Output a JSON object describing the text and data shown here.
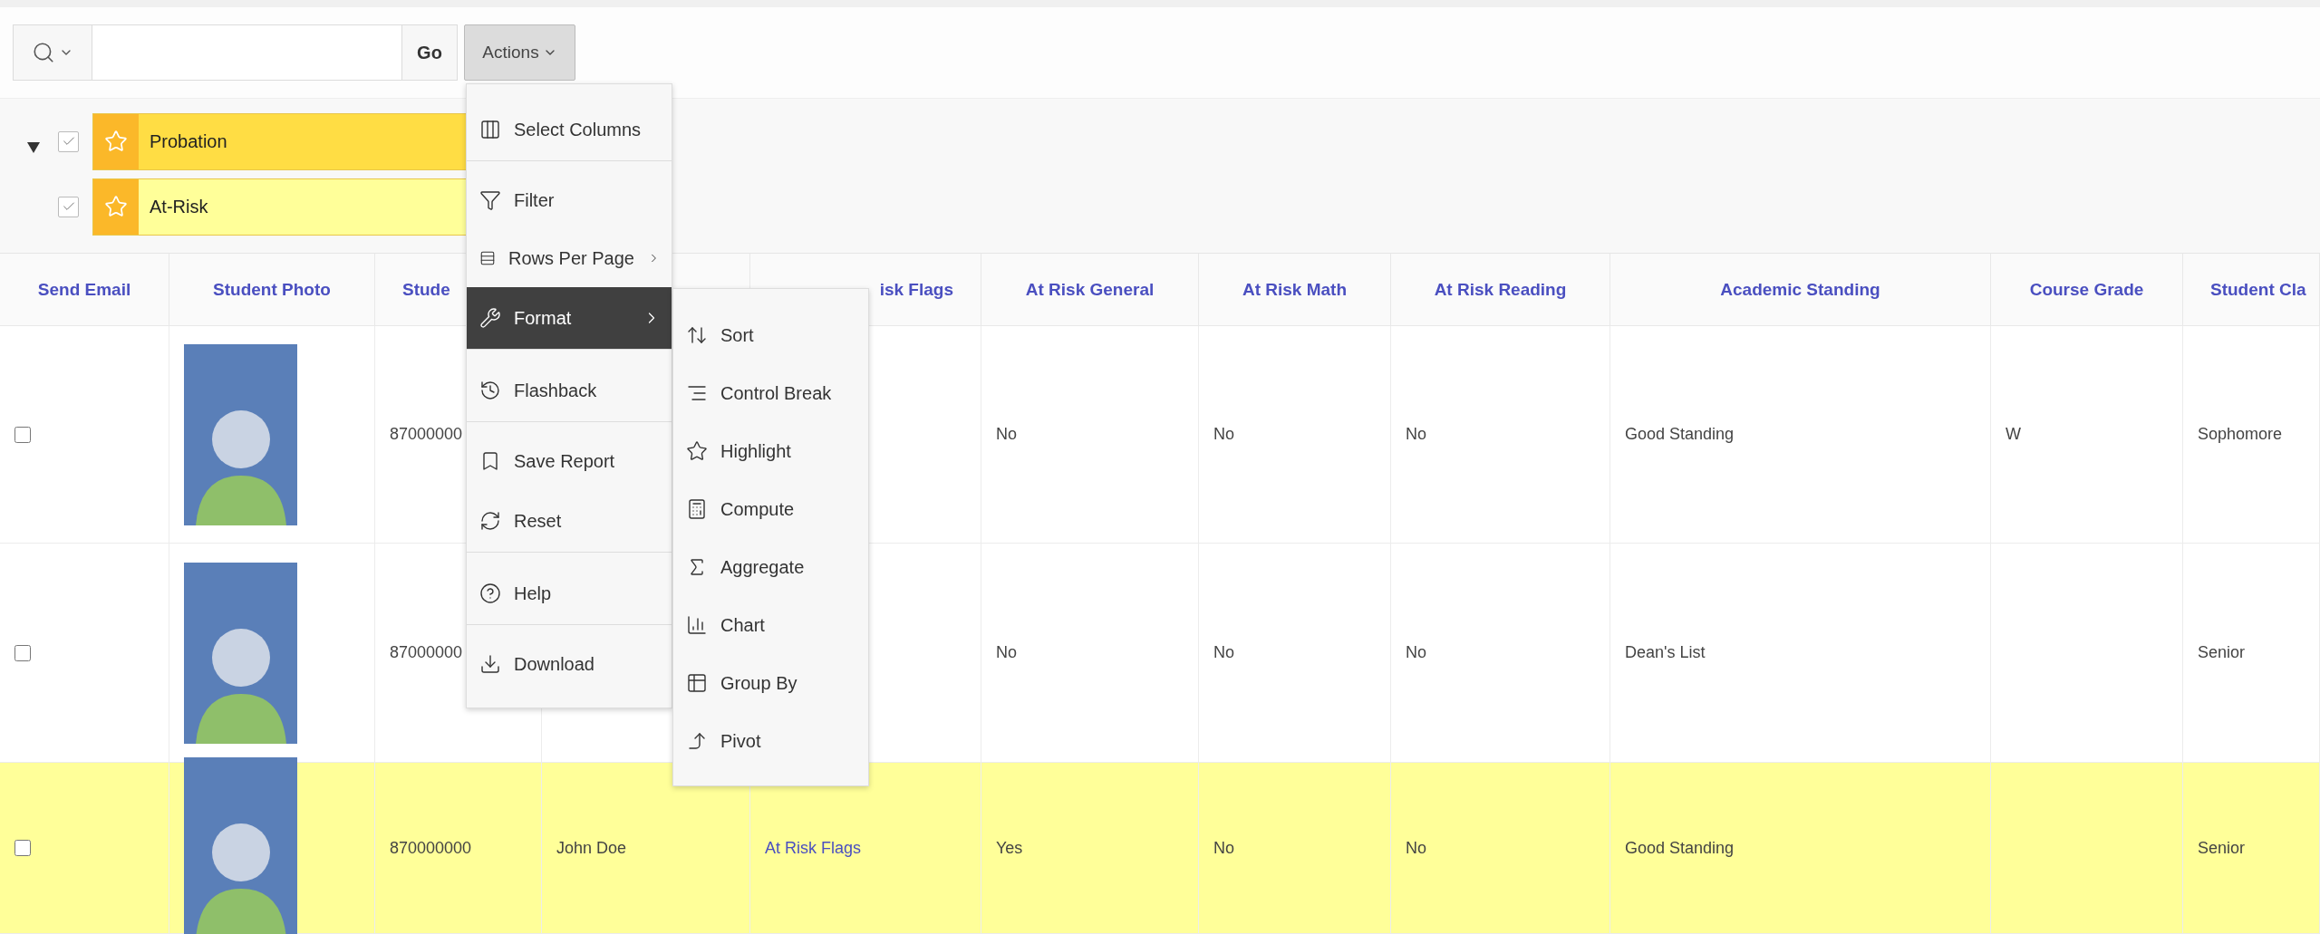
{
  "toolbar": {
    "go_button": "Go",
    "actions_button": "Actions"
  },
  "actions_menu": [
    {
      "label": "Select Columns",
      "selected": false,
      "submenu": false,
      "divider_after": true
    },
    {
      "label": "Filter",
      "selected": false,
      "submenu": false,
      "divider_after": false
    },
    {
      "label": "Rows Per Page",
      "selected": false,
      "submenu": true,
      "divider_after": false
    },
    {
      "label": "Format",
      "selected": true,
      "submenu": true,
      "divider_after": true
    },
    {
      "label": "Flashback",
      "selected": false,
      "submenu": false,
      "divider_after": true
    },
    {
      "label": "Save Report",
      "selected": false,
      "submenu": false,
      "divider_after": false
    },
    {
      "label": "Reset",
      "selected": false,
      "submenu": false,
      "divider_after": true
    },
    {
      "label": "Help",
      "selected": false,
      "submenu": false,
      "divider_after": true
    },
    {
      "label": "Download",
      "selected": false,
      "submenu": false,
      "divider_after": false
    }
  ],
  "format_submenu": [
    "Sort",
    "Control Break",
    "Highlight",
    "Compute",
    "Aggregate",
    "Chart",
    "Group By",
    "Pivot"
  ],
  "filters": {
    "expanded": true,
    "items": [
      {
        "label": "Probation",
        "checked": true,
        "color": "#ffdd44"
      },
      {
        "label": "At-Risk",
        "checked": true,
        "color": "#ffff99"
      }
    ]
  },
  "table": {
    "columns": [
      {
        "label": "Send Email",
        "kind": "checkbox"
      },
      {
        "label": "Student Photo",
        "kind": "photo"
      },
      {
        "label": "Stude",
        "kind": "text"
      },
      {
        "kind": "text"
      },
      {
        "label": "isk Flags",
        "kind": "link"
      },
      {
        "label": "At Risk General",
        "kind": "text"
      },
      {
        "label": "At Risk Math",
        "kind": "text"
      },
      {
        "label": "At Risk Reading",
        "kind": "text"
      },
      {
        "label": "Academic Standing",
        "kind": "text"
      },
      {
        "label": "Course Grade",
        "kind": "text"
      },
      {
        "label": "Student Cla",
        "kind": "text"
      }
    ],
    "rows": [
      {
        "checked": false,
        "highlighted": false,
        "cells": [
          "",
          "",
          "87000000",
          "",
          "",
          "No",
          "No",
          "No",
          "Good Standing",
          "W",
          "Sophomore"
        ]
      },
      {
        "checked": false,
        "highlighted": false,
        "cells": [
          "",
          "",
          "87000000",
          "",
          "",
          "No",
          "No",
          "No",
          "Dean's List",
          "",
          "Senior"
        ]
      },
      {
        "checked": false,
        "highlighted": true,
        "cells": [
          "",
          "",
          "870000000",
          "John Doe",
          "At Risk Flags",
          "Yes",
          "No",
          "No",
          "Good Standing",
          "",
          "Senior"
        ]
      }
    ]
  }
}
